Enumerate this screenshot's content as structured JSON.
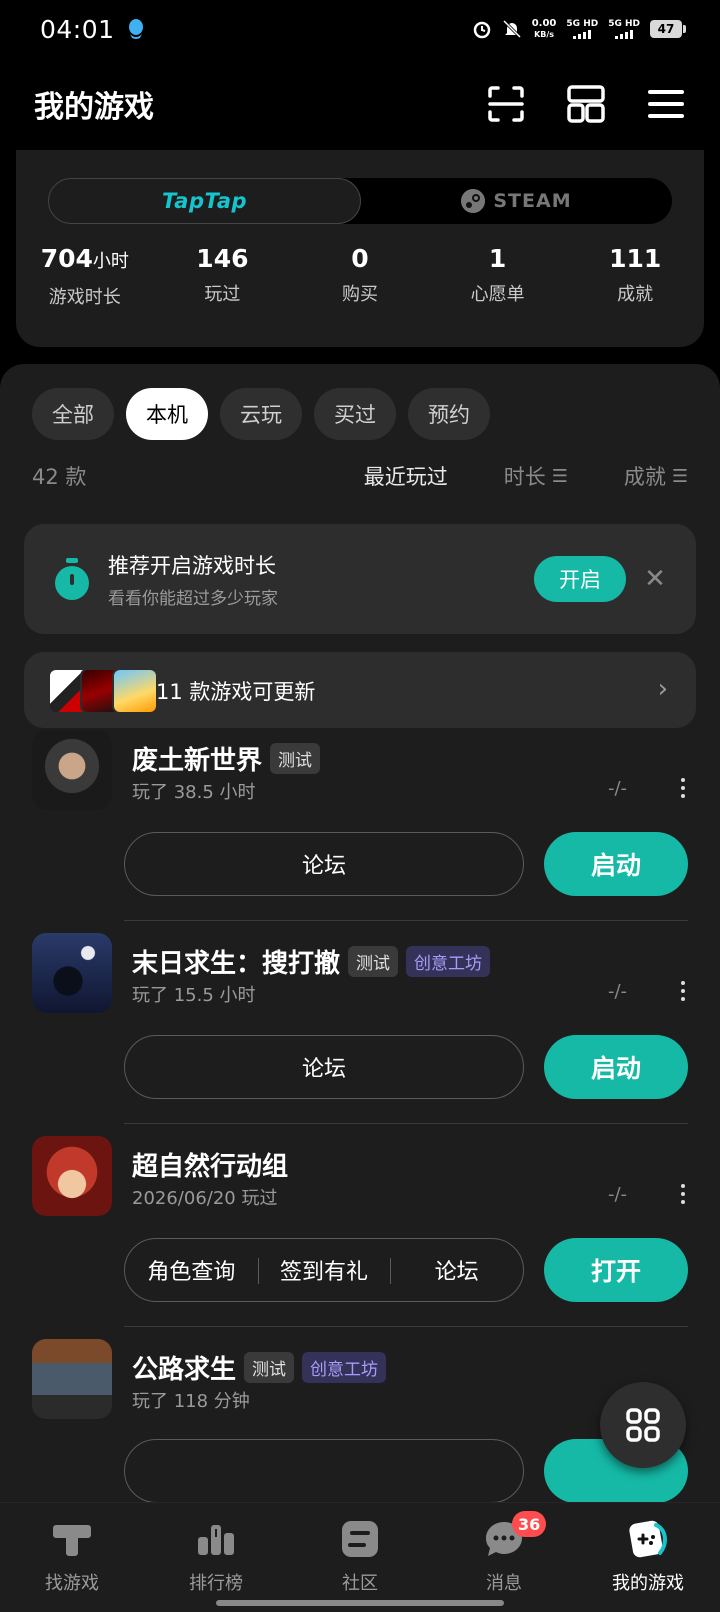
{
  "status_bar": {
    "time": "04:01",
    "net_speed_value": "0.00",
    "net_speed_unit": "KB/s",
    "signal1_label": "5G HD",
    "signal2_label": "5G HD",
    "battery": "47"
  },
  "header": {
    "title": "我的游戏",
    "actions": [
      "scan-icon",
      "grid-icon",
      "menu-icon"
    ]
  },
  "platforms": {
    "taptap": "TapTap",
    "steam": "STEAM",
    "selected": "TapTap"
  },
  "stats": [
    {
      "value": "704",
      "unit": "小时",
      "label": "游戏时长"
    },
    {
      "value": "146",
      "unit": "",
      "label": "玩过"
    },
    {
      "value": "0",
      "unit": "",
      "label": "购买"
    },
    {
      "value": "1",
      "unit": "",
      "label": "心愿单"
    },
    {
      "value": "111",
      "unit": "",
      "label": "成就"
    }
  ],
  "filters": {
    "chips": [
      "全部",
      "本机",
      "云玩",
      "买过",
      "预约"
    ],
    "selected": "本机"
  },
  "list_meta": {
    "count": "42 款",
    "sort_options": [
      "最近玩过",
      "时长",
      "成就"
    ],
    "sort_selected": "最近玩过"
  },
  "promo": {
    "title": "推荐开启游戏时长",
    "subtitle": "看看你能超过多少玩家",
    "button": "开启"
  },
  "updates": {
    "text": "11 款游戏可更新"
  },
  "games": [
    {
      "title": "废土新世界",
      "tags": [
        "测试"
      ],
      "subtitle": "玩了 38.5 小时",
      "progress": "-/-",
      "actions": [
        "论坛"
      ],
      "primary": "启动"
    },
    {
      "title": "末日求生：搜打撤",
      "tags": [
        "测试",
        "创意工坊"
      ],
      "subtitle": "玩了 15.5 小时",
      "progress": "-/-",
      "actions": [
        "论坛"
      ],
      "primary": "启动"
    },
    {
      "title": "超自然行动组",
      "tags": [],
      "subtitle": "2026/06/20 玩过",
      "progress": "-/-",
      "actions": [
        "角色查询",
        "签到有礼",
        "论坛"
      ],
      "primary": "打开"
    },
    {
      "title": "公路求生",
      "tags": [
        "测试",
        "创意工坊"
      ],
      "subtitle": "玩了 118 分钟",
      "progress": "",
      "actions": [],
      "primary": ""
    }
  ],
  "bottom_nav": [
    {
      "label": "找游戏",
      "icon": "find-game-icon"
    },
    {
      "label": "排行榜",
      "icon": "ranking-icon"
    },
    {
      "label": "社区",
      "icon": "community-icon"
    },
    {
      "label": "消息",
      "icon": "message-icon",
      "badge": "36"
    },
    {
      "label": "我的游戏",
      "icon": "my-games-icon",
      "active": true
    }
  ],
  "colors": {
    "accent": "#15b9a6",
    "taptap": "#15c5ce",
    "badge": "#ff4d4f",
    "workshop_tag": "#a79cf6"
  }
}
